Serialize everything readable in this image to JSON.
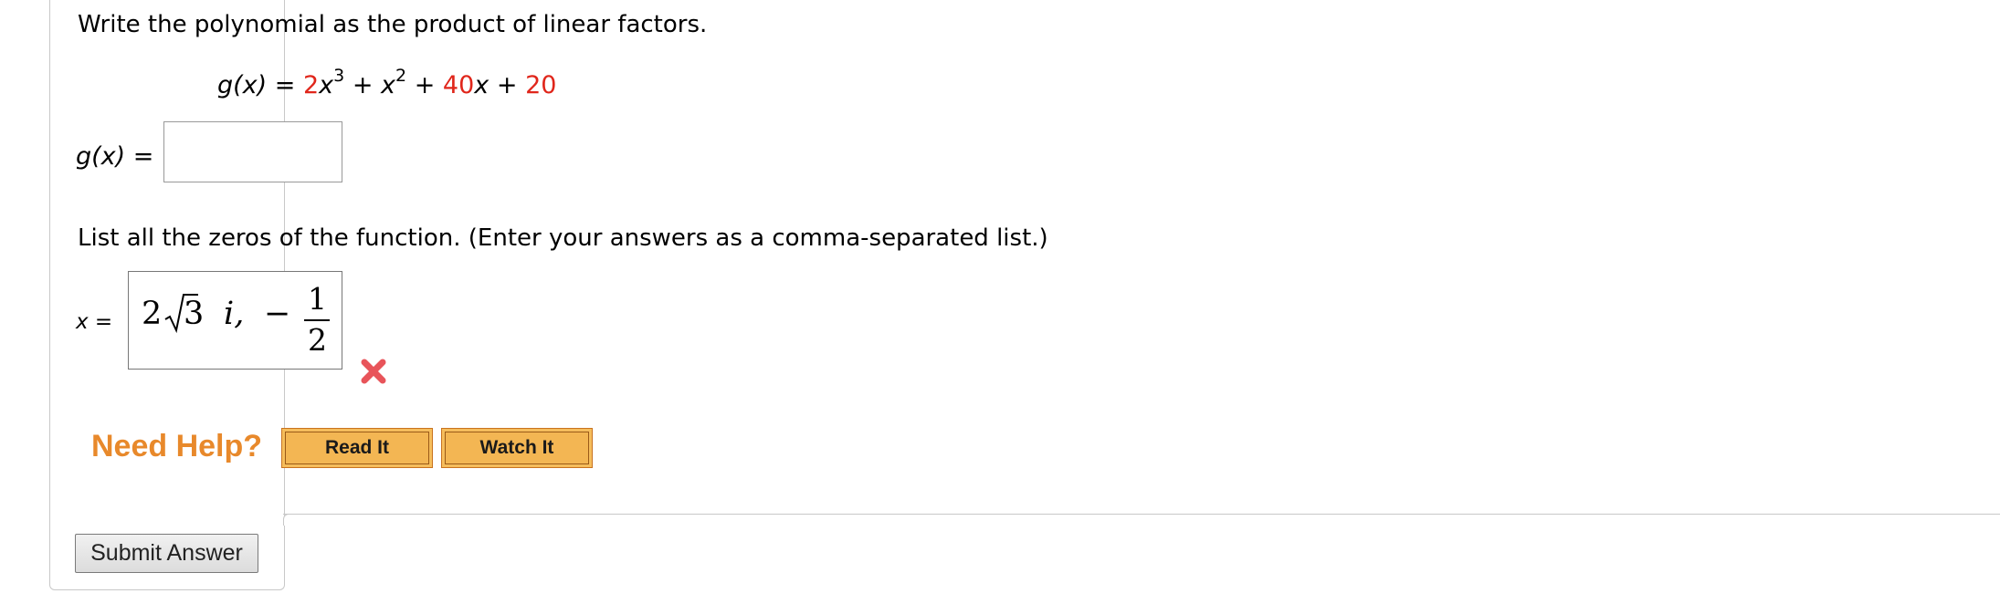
{
  "question": {
    "instruction": "Write the polynomial as the product of linear factors.",
    "equation": {
      "lhs": "g(x) =",
      "t1_coef": "2",
      "t1_var": "x",
      "t1_exp": "3",
      "plus1": " + ",
      "t2_var": "x",
      "t2_exp": "2",
      "plus2": " + ",
      "t3_coef": "40",
      "t3_var": "x",
      "plus3": " + ",
      "t4": "20",
      "highlight_color": "#e0261b"
    },
    "factor_answer": {
      "label": "g(x) =",
      "value": ""
    },
    "zeros_instruction": "List all the zeros of the function. (Enter your answers as a comma-separated list.)",
    "zeros_answer": {
      "label": "x =",
      "coef": "2",
      "radicand": "3",
      "imag": "i,",
      "minus": "−",
      "frac_num": "1",
      "frac_den": "2",
      "status": "incorrect",
      "status_icon": "red-x-icon"
    }
  },
  "help": {
    "label": "Need Help?",
    "read_it": "Read It",
    "watch_it": "Watch It"
  },
  "submit_label": "Submit Answer"
}
